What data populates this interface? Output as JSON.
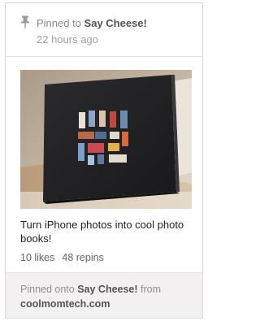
{
  "header": {
    "pinned_prefix": "Pinned to ",
    "board_name": "Say Cheese!",
    "time_ago": "22 hours ago",
    "icon": "pushpin-icon"
  },
  "pin": {
    "image": "photo-book-image",
    "description": "Turn iPhone photos into cool photo books!",
    "likes": "10 likes",
    "repins": "48 repins"
  },
  "footer": {
    "pinned_onto_prefix": "Pinned onto ",
    "board_name": "Say Cheese!",
    "from_text": " from",
    "source": "coolmomtech.com"
  }
}
